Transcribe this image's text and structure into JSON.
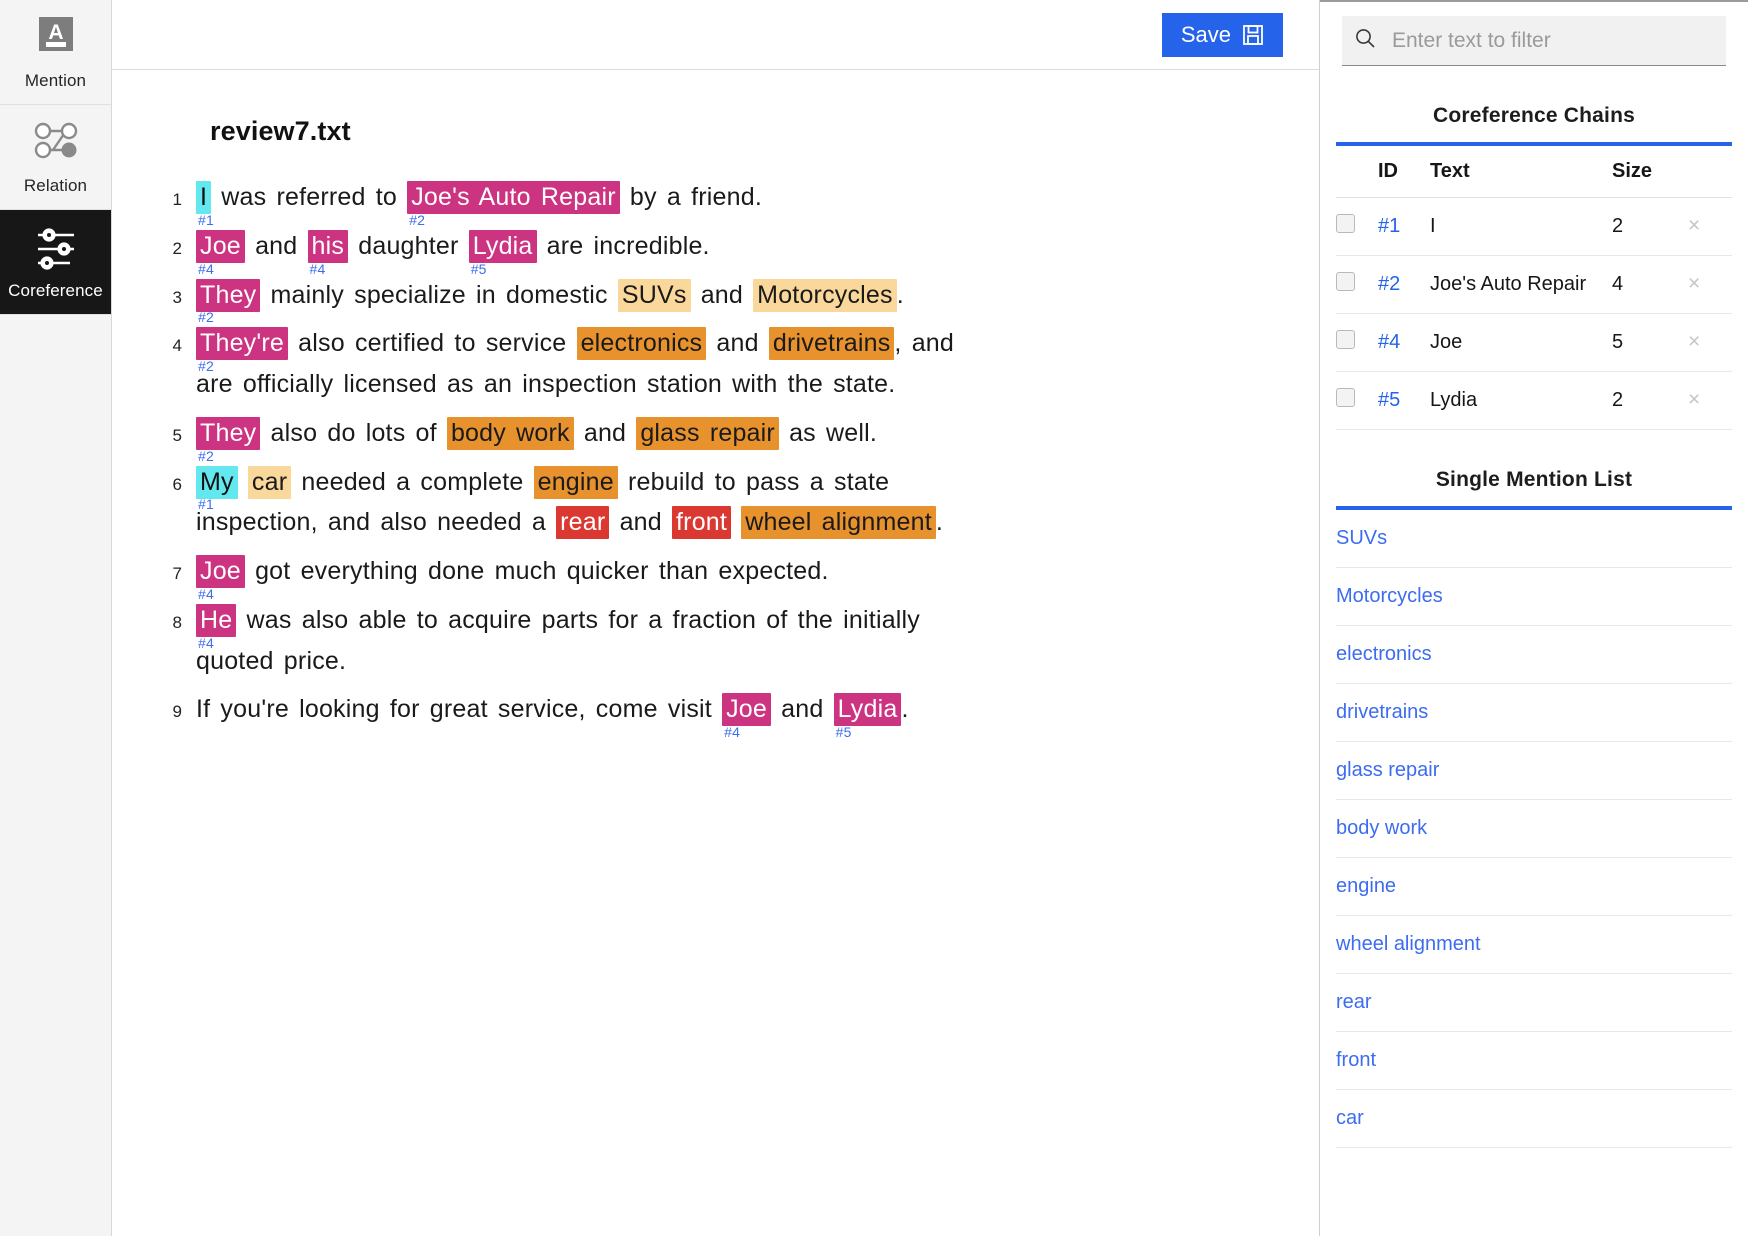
{
  "rail": {
    "items": [
      {
        "label": "Mention",
        "icon": "letter-a-annotate-icon",
        "active": false
      },
      {
        "label": "Relation",
        "icon": "relation-graph-icon",
        "active": false
      },
      {
        "label": "Coreference",
        "icon": "sliders-icon",
        "active": true
      }
    ]
  },
  "toolbar": {
    "save_label": "Save",
    "save_icon": "floppy-disk-icon"
  },
  "document": {
    "title": "review7.txt",
    "lines": [
      {
        "number": "1",
        "segments": [
          {
            "text": "I",
            "style": "c1",
            "tag": "#1"
          },
          {
            "text": " was referred to "
          },
          {
            "text": "Joe's Auto Repair",
            "style": "c2",
            "tag": "#2"
          },
          {
            "text": " by a friend."
          }
        ]
      },
      {
        "number": "2",
        "segments": [
          {
            "text": "Joe",
            "style": "c4",
            "tag": "#4"
          },
          {
            "text": " and "
          },
          {
            "text": "his",
            "style": "c4",
            "tag": "#4"
          },
          {
            "text": " daughter "
          },
          {
            "text": "Lydia",
            "style": "c5",
            "tag": "#5"
          },
          {
            "text": " are incredible."
          }
        ]
      },
      {
        "number": "3",
        "segments": [
          {
            "text": "They",
            "style": "c2",
            "tag": "#2"
          },
          {
            "text": " mainly specialize in domestic "
          },
          {
            "text": "SUVs",
            "style": "tan"
          },
          {
            "text": " and "
          },
          {
            "text": "Motorcycles",
            "style": "tan"
          },
          {
            "text": "."
          }
        ]
      },
      {
        "number": "4",
        "segments": [
          {
            "text": "They're",
            "style": "c2",
            "tag": "#2"
          },
          {
            "text": " also certified to service "
          },
          {
            "text": "electronics",
            "style": "orange"
          },
          {
            "text": " and "
          },
          {
            "text": "drivetrains",
            "style": "orange"
          },
          {
            "text": ", and"
          }
        ],
        "continuation": [
          {
            "text": "are officially licensed as an inspection station with the state."
          }
        ]
      },
      {
        "number": "5",
        "segments": [
          {
            "text": "They",
            "style": "c2",
            "tag": "#2"
          },
          {
            "text": " also do lots of "
          },
          {
            "text": "body work",
            "style": "orange"
          },
          {
            "text": " and "
          },
          {
            "text": "glass repair",
            "style": "orange"
          },
          {
            "text": " as well."
          }
        ]
      },
      {
        "number": "6",
        "segments": [
          {
            "text": "My",
            "style": "c1",
            "tag": "#1"
          },
          {
            "text": " "
          },
          {
            "text": "car",
            "style": "tan"
          },
          {
            "text": " needed a complete "
          },
          {
            "text": "engine",
            "style": "orange"
          },
          {
            "text": " rebuild to pass a state"
          }
        ],
        "continuation": [
          {
            "text": "inspection, and also needed a "
          },
          {
            "text": "rear",
            "style": "red"
          },
          {
            "text": " and "
          },
          {
            "text": "front",
            "style": "red"
          },
          {
            "text": " "
          },
          {
            "text": "wheel alignment",
            "style": "orange"
          },
          {
            "text": "."
          }
        ]
      },
      {
        "number": "7",
        "segments": [
          {
            "text": "Joe",
            "style": "c4",
            "tag": "#4"
          },
          {
            "text": " got everything done much quicker than expected."
          }
        ]
      },
      {
        "number": "8",
        "segments": [
          {
            "text": "He",
            "style": "c4",
            "tag": "#4"
          },
          {
            "text": " was also able to acquire parts for a fraction of the initially"
          }
        ],
        "continuation": [
          {
            "text": "quoted price."
          }
        ]
      },
      {
        "number": "9",
        "segments": [
          {
            "text": "If you're looking for great service, come visit "
          },
          {
            "text": "Joe",
            "style": "c4",
            "tag": "#4"
          },
          {
            "text": " and "
          },
          {
            "text": "Lydia",
            "style": "c5",
            "tag": "#5"
          },
          {
            "text": "."
          }
        ]
      }
    ]
  },
  "right_panel": {
    "filter": {
      "placeholder": "Enter text to filter",
      "value": "",
      "icon": "search-icon"
    },
    "chains": {
      "title": "Coreference Chains",
      "columns": {
        "id": "ID",
        "text": "Text",
        "size": "Size"
      },
      "remove_label": "×",
      "rows": [
        {
          "id": "#1",
          "text": "I",
          "size": "2"
        },
        {
          "id": "#2",
          "text": "Joe's Auto Repair",
          "size": "4"
        },
        {
          "id": "#4",
          "text": "Joe",
          "size": "5"
        },
        {
          "id": "#5",
          "text": "Lydia",
          "size": "2"
        }
      ]
    },
    "single_mentions": {
      "title": "Single Mention List",
      "items": [
        "SUVs",
        "Motorcycles",
        "electronics",
        "drivetrains",
        "glass repair",
        "body work",
        "engine",
        "wheel alignment",
        "rear",
        "front",
        "car"
      ]
    }
  },
  "colors": {
    "accent_blue": "#2563eb",
    "link_blue": "#3d6cf0",
    "chain_cyan": "#63e8f0",
    "chain_magenta": "#cc3380",
    "mention_tan": "#fad79a",
    "mention_orange": "#e8922e",
    "mention_red": "#db3832",
    "rail_active_bg": "#171717"
  }
}
